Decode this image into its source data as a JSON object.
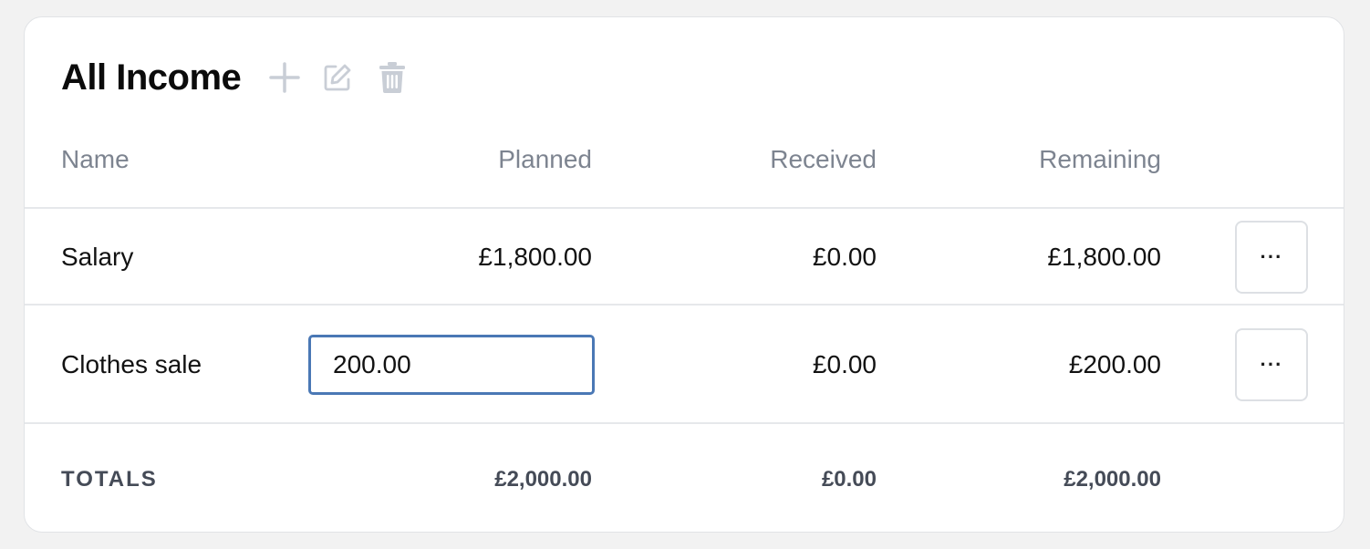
{
  "panel": {
    "title": "All Income",
    "actions": [
      {
        "icon": "plus-icon",
        "label": "Add income"
      },
      {
        "icon": "edit-icon",
        "label": "Edit"
      },
      {
        "icon": "trash-icon",
        "label": "Delete"
      }
    ],
    "icon_color": "#c9ced6"
  },
  "table": {
    "columns": [
      "Name",
      "Planned",
      "Received",
      "Remaining"
    ],
    "rows": [
      {
        "name": "Salary",
        "planned": "£1,800.00",
        "received": "£0.00",
        "remaining": "£1,800.00",
        "menu": "···"
      },
      {
        "name": "Clothes sale",
        "planned_input": "200.00",
        "received": "£0.00",
        "remaining": "£200.00",
        "menu": "···"
      }
    ],
    "totals": {
      "label": "TOTALS",
      "planned": "£2,000.00",
      "received": "£0.00",
      "remaining": "£2,000.00"
    }
  },
  "colors": {
    "focus_border": "#4a78b5",
    "header_text": "#7d8490",
    "totals_text": "#454b57"
  }
}
